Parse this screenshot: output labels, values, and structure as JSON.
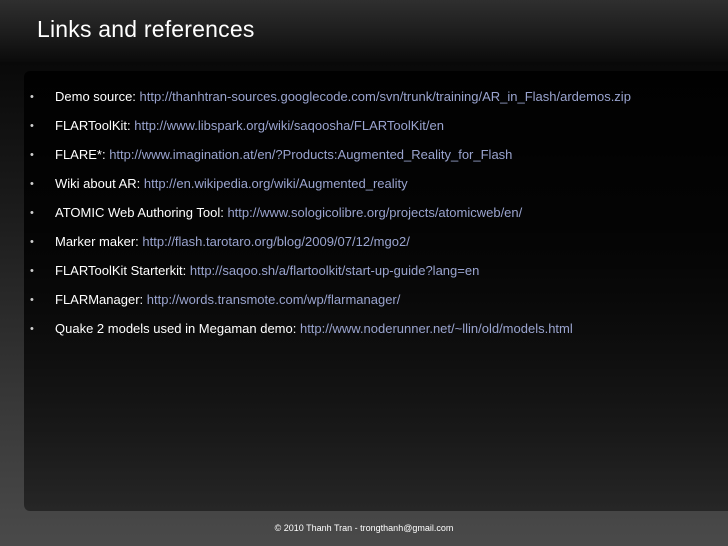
{
  "slide": {
    "title": "Links and references",
    "bullet": "•",
    "items": [
      {
        "label": "Demo source:",
        "url": "http://thanhtran-sources.googlecode.com/svn/trunk/training/AR_in_Flash/ardemos.zip"
      },
      {
        "label": "FLARToolKit:",
        "url": "http://www.libspark.org/wiki/saqoosha/FLARToolKit/en"
      },
      {
        "label": "FLARE*:",
        "url": "http://www.imagination.at/en/?Products:Augmented_Reality_for_Flash"
      },
      {
        "label": "Wiki about AR:",
        "url": "http://en.wikipedia.org/wiki/Augmented_reality"
      },
      {
        "label": "ATOMIC Web Authoring Tool:",
        "url": "http://www.sologicolibre.org/projects/atomicweb/en/"
      },
      {
        "label": "Marker maker:",
        "url": "http://flash.tarotaro.org/blog/2009/07/12/mgo2/"
      },
      {
        "label": "FLARToolKit Starterkit:",
        "url": "http://saqoo.sh/a/flartoolkit/start-up-guide?lang=en"
      },
      {
        "label": "FLARManager:",
        "url": "http://words.transmote.com/wp/flarmanager/"
      },
      {
        "label": "Quake 2 models used in Megaman demo:",
        "url": "http://www.noderunner.net/~llin/old/models.html"
      }
    ],
    "footer": "© 2010 Thanh Tran - trongthanh@gmail.com"
  },
  "colors": {
    "title_text": "#ffffff",
    "label_text": "#ffffff",
    "link_text": "#9aa4cf",
    "background": "#000000"
  }
}
